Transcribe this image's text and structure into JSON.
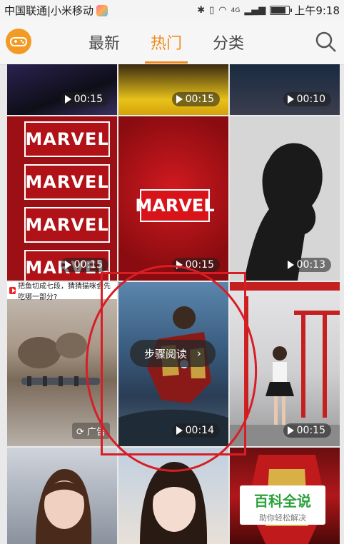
{
  "status_bar": {
    "carrier": "中国联通|小米移动",
    "network": "4G",
    "time": "上午9:18"
  },
  "header": {
    "tabs": [
      {
        "label": "最新",
        "active": false
      },
      {
        "label": "热门",
        "active": true
      },
      {
        "label": "分类",
        "active": false
      }
    ],
    "icons": {
      "logo": "game-controller-icon",
      "search": "search-icon"
    }
  },
  "videos": [
    {
      "duration": "00:15"
    },
    {
      "duration": "00:15"
    },
    {
      "duration": "00:10"
    },
    {
      "duration": "00:15",
      "titles": [
        "MARVEL",
        "MARVEL",
        "MARVEL",
        "MARVEL",
        "MARVEL"
      ]
    },
    {
      "duration": "00:15",
      "title": "MARVEL"
    },
    {
      "duration": "00:13"
    },
    {
      "duration": "00:14"
    },
    {
      "duration": "00:15"
    }
  ],
  "ad": {
    "title": "把鱼切成七段，猜猜猫咪会先吃哪一部分?",
    "tag": "广告"
  },
  "overlay": {
    "steps_label": "步骤阅读",
    "steps_chevron": "›"
  },
  "watermark": {
    "title": "百科全说",
    "subtitle": "助你轻松解决"
  },
  "colors": {
    "accent": "#f08a1c",
    "annotation": "#d81e25",
    "marvel_red": "#b01217"
  }
}
